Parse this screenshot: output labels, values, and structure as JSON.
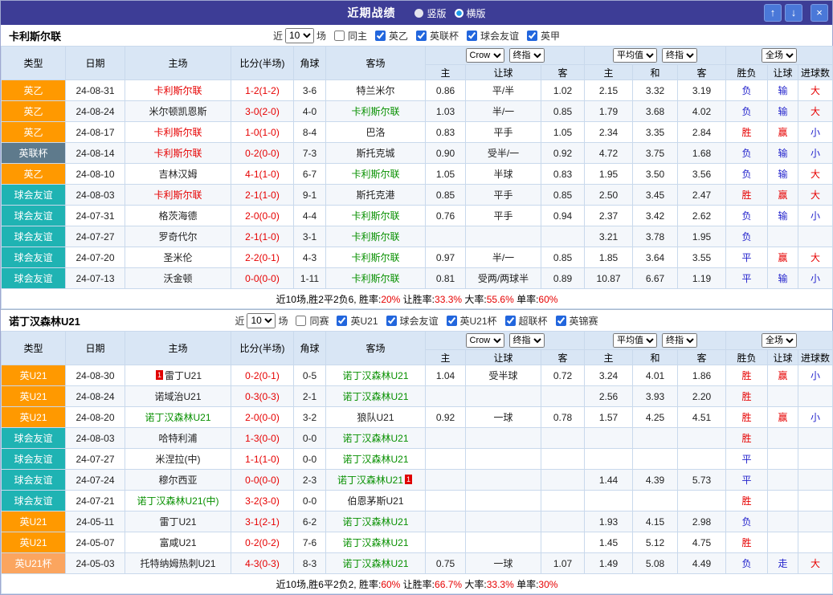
{
  "titlebar": {
    "title": "近期战绩",
    "radios": [
      {
        "label": "竖版",
        "selected": false
      },
      {
        "label": "横版",
        "selected": true
      }
    ],
    "buttons": [
      {
        "name": "up",
        "glyph": "↑"
      },
      {
        "name": "down",
        "glyph": "↓"
      },
      {
        "name": "close",
        "glyph": "×"
      }
    ]
  },
  "colors": {
    "topbar": "#3D3D96",
    "button_blue": "#4A78D8",
    "header_bg": "#D9E6F5",
    "grid_border": "#C9D9EC",
    "row_alt": "#F4F7FB",
    "red": "#E60000",
    "green": "#079000",
    "blue": "#2323CC",
    "badge_orange": "#FF9900",
    "badge_slate": "#5E7A8C",
    "badge_teal": "#1FB3B3",
    "badge_orangeLight": "#FBA55F"
  },
  "table_header": {
    "left_cols": [
      "类型",
      "日期",
      "主场",
      "比分(半场)",
      "角球",
      "客场"
    ],
    "group1": {
      "selects": [
        "Crow",
        "终指"
      ],
      "cols": [
        "主",
        "让球",
        "客"
      ]
    },
    "group2": {
      "selects": [
        "平均值",
        "终指"
      ],
      "cols": [
        "主",
        "和",
        "客"
      ]
    },
    "group3": {
      "selects": [
        "全场"
      ],
      "cols": [
        "胜负",
        "让球",
        "进球数"
      ]
    }
  },
  "sections": [
    {
      "team": "卡利斯尔联",
      "controls": {
        "near_label": "近",
        "count": "10",
        "matches_label": "场",
        "same_label": "同主",
        "same_checked": false,
        "leagues": [
          {
            "label": "英乙",
            "checked": true
          },
          {
            "label": "英联杯",
            "checked": true
          },
          {
            "label": "球会友谊",
            "checked": true
          },
          {
            "label": "英甲",
            "checked": true
          }
        ]
      },
      "rows": [
        {
          "type": "英乙",
          "tc": "orange",
          "date": "24-08-31",
          "home": "卡利斯尔联",
          "hc": "red",
          "score": "1-2(1-2)",
          "corner": "3-6",
          "away": "特兰米尔",
          "ac": "",
          "o1": "0.86",
          "o2": "平/半",
          "o3": "1.02",
          "a1": "2.15",
          "a2": "3.32",
          "a3": "3.19",
          "r1": "负",
          "r1c": "blue",
          "r2": "输",
          "r2c": "blue",
          "r3": "大",
          "r3c": "red"
        },
        {
          "type": "英乙",
          "tc": "orange",
          "date": "24-08-24",
          "home": "米尔顿凯恩斯",
          "hc": "",
          "score": "3-0(2-0)",
          "corner": "4-0",
          "away": "卡利斯尔联",
          "ac": "green",
          "o1": "1.03",
          "o2": "半/一",
          "o3": "0.85",
          "a1": "1.79",
          "a2": "3.68",
          "a3": "4.02",
          "r1": "负",
          "r1c": "blue",
          "r2": "输",
          "r2c": "blue",
          "r3": "大",
          "r3c": "red"
        },
        {
          "type": "英乙",
          "tc": "orange",
          "date": "24-08-17",
          "home": "卡利斯尔联",
          "hc": "red",
          "score": "1-0(1-0)",
          "corner": "8-4",
          "away": "巴洛",
          "ac": "",
          "o1": "0.83",
          "o2": "平手",
          "o3": "1.05",
          "a1": "2.34",
          "a2": "3.35",
          "a3": "2.84",
          "r1": "胜",
          "r1c": "red",
          "r2": "赢",
          "r2c": "red",
          "r3": "小",
          "r3c": "blue"
        },
        {
          "type": "英联杯",
          "tc": "slate",
          "date": "24-08-14",
          "home": "卡利斯尔联",
          "hc": "red",
          "score": "0-2(0-0)",
          "corner": "7-3",
          "away": "斯托克城",
          "ac": "",
          "o1": "0.90",
          "o2": "受半/一",
          "o3": "0.92",
          "a1": "4.72",
          "a2": "3.75",
          "a3": "1.68",
          "r1": "负",
          "r1c": "blue",
          "r2": "输",
          "r2c": "blue",
          "r3": "小",
          "r3c": "blue"
        },
        {
          "type": "英乙",
          "tc": "orange",
          "date": "24-08-10",
          "home": "吉林汉姆",
          "hc": "",
          "score": "4-1(1-0)",
          "corner": "6-7",
          "away": "卡利斯尔联",
          "ac": "green",
          "o1": "1.05",
          "o2": "半球",
          "o3": "0.83",
          "a1": "1.95",
          "a2": "3.50",
          "a3": "3.56",
          "r1": "负",
          "r1c": "blue",
          "r2": "输",
          "r2c": "blue",
          "r3": "大",
          "r3c": "red"
        },
        {
          "type": "球会友谊",
          "tc": "teal",
          "date": "24-08-03",
          "home": "卡利斯尔联",
          "hc": "red",
          "score": "2-1(1-0)",
          "corner": "9-1",
          "away": "斯托克港",
          "ac": "",
          "o1": "0.85",
          "o2": "平手",
          "o3": "0.85",
          "a1": "2.50",
          "a2": "3.45",
          "a3": "2.47",
          "r1": "胜",
          "r1c": "red",
          "r2": "赢",
          "r2c": "red",
          "r3": "大",
          "r3c": "red"
        },
        {
          "type": "球会友谊",
          "tc": "teal",
          "date": "24-07-31",
          "home": "格茨海德",
          "hc": "",
          "score": "2-0(0-0)",
          "corner": "4-4",
          "away": "卡利斯尔联",
          "ac": "green",
          "o1": "0.76",
          "o2": "平手",
          "o3": "0.94",
          "a1": "2.37",
          "a2": "3.42",
          "a3": "2.62",
          "r1": "负",
          "r1c": "blue",
          "r2": "输",
          "r2c": "blue",
          "r3": "小",
          "r3c": "blue"
        },
        {
          "type": "球会友谊",
          "tc": "teal",
          "date": "24-07-27",
          "home": "罗奇代尔",
          "hc": "",
          "score": "2-1(1-0)",
          "corner": "3-1",
          "away": "卡利斯尔联",
          "ac": "green",
          "a1": "3.21",
          "a2": "3.78",
          "a3": "1.95",
          "r1": "负",
          "r1c": "blue"
        },
        {
          "type": "球会友谊",
          "tc": "teal",
          "date": "24-07-20",
          "home": "圣米伦",
          "hc": "",
          "score": "2-2(0-1)",
          "corner": "4-3",
          "away": "卡利斯尔联",
          "ac": "green",
          "o1": "0.97",
          "o2": "半/一",
          "o3": "0.85",
          "a1": "1.85",
          "a2": "3.64",
          "a3": "3.55",
          "r1": "平",
          "r1c": "blue",
          "r2": "赢",
          "r2c": "red",
          "r3": "大",
          "r3c": "red"
        },
        {
          "type": "球会友谊",
          "tc": "teal",
          "date": "24-07-13",
          "home": "沃金顿",
          "hc": "",
          "score": "0-0(0-0)",
          "corner": "1-11",
          "away": "卡利斯尔联",
          "ac": "green",
          "o1": "0.81",
          "o2": "受两/两球半",
          "o3": "0.89",
          "a1": "10.87",
          "a2": "6.67",
          "a3": "1.19",
          "r1": "平",
          "r1c": "blue",
          "r2": "输",
          "r2c": "blue",
          "r3": "小",
          "r3c": "blue"
        }
      ],
      "summary": [
        {
          "t": "近10场,胜2平2负6, 胜率:",
          "red": false
        },
        {
          "t": "20%",
          "red": true
        },
        {
          "t": " 让胜率:",
          "red": false
        },
        {
          "t": "33.3%",
          "red": true
        },
        {
          "t": " 大率:",
          "red": false
        },
        {
          "t": "55.6%",
          "red": true
        },
        {
          "t": " 单率:",
          "red": false
        },
        {
          "t": "60%",
          "red": true
        }
      ]
    },
    {
      "team": "诺丁汉森林U21",
      "controls": {
        "near_label": "近",
        "count": "10",
        "matches_label": "场",
        "same_label": "同赛",
        "same_checked": false,
        "leagues": [
          {
            "label": "英U21",
            "checked": true
          },
          {
            "label": "球会友谊",
            "checked": true
          },
          {
            "label": "英U21杯",
            "checked": true
          },
          {
            "label": "超联杯",
            "checked": true
          },
          {
            "label": "英锦赛",
            "checked": true
          }
        ]
      },
      "rows": [
        {
          "type": "英U21",
          "tc": "orange",
          "date": "24-08-30",
          "home": "雷丁U21",
          "hc": "",
          "hcard": "1",
          "score": "0-2(0-1)",
          "corner": "0-5",
          "away": "诺丁汉森林U21",
          "ac": "green",
          "o1": "1.04",
          "o2": "受半球",
          "o3": "0.72",
          "a1": "3.24",
          "a2": "4.01",
          "a3": "1.86",
          "r1": "胜",
          "r1c": "red",
          "r2": "赢",
          "r2c": "red",
          "r3": "小",
          "r3c": "blue"
        },
        {
          "type": "英U21",
          "tc": "orange",
          "date": "24-08-24",
          "home": "诺域治U21",
          "hc": "",
          "score": "0-3(0-3)",
          "corner": "2-1",
          "away": "诺丁汉森林U21",
          "ac": "green",
          "a1": "2.56",
          "a2": "3.93",
          "a3": "2.20",
          "r1": "胜",
          "r1c": "red"
        },
        {
          "type": "英U21",
          "tc": "orange",
          "date": "24-08-20",
          "home": "诺丁汉森林U21",
          "hc": "green",
          "score": "2-0(0-0)",
          "corner": "3-2",
          "away": "狼队U21",
          "ac": "",
          "o1": "0.92",
          "o2": "一球",
          "o3": "0.78",
          "a1": "1.57",
          "a2": "4.25",
          "a3": "4.51",
          "r1": "胜",
          "r1c": "red",
          "r2": "赢",
          "r2c": "red",
          "r3": "小",
          "r3c": "blue"
        },
        {
          "type": "球会友谊",
          "tc": "teal",
          "date": "24-08-03",
          "home": "哈特利浦",
          "hc": "",
          "score": "1-3(0-0)",
          "corner": "0-0",
          "away": "诺丁汉森林U21",
          "ac": "green",
          "r1": "胜",
          "r1c": "red"
        },
        {
          "type": "球会友谊",
          "tc": "teal",
          "date": "24-07-27",
          "home": "米涅拉(中)",
          "hc": "",
          "score": "1-1(1-0)",
          "corner": "0-0",
          "away": "诺丁汉森林U21",
          "ac": "green",
          "r1": "平",
          "r1c": "blue"
        },
        {
          "type": "球会友谊",
          "tc": "teal",
          "date": "24-07-24",
          "home": "穆尔西亚",
          "hc": "",
          "score": "0-0(0-0)",
          "corner": "2-3",
          "away": "诺丁汉森林U21",
          "ac": "green",
          "acard": "1",
          "a1": "1.44",
          "a2": "4.39",
          "a3": "5.73",
          "r1": "平",
          "r1c": "blue"
        },
        {
          "type": "球会友谊",
          "tc": "teal",
          "date": "24-07-21",
          "home": "诺丁汉森林U21(中)",
          "hc": "green",
          "score": "3-2(3-0)",
          "corner": "0-0",
          "away": "伯恩茅斯U21",
          "ac": "",
          "r1": "胜",
          "r1c": "red"
        },
        {
          "type": "英U21",
          "tc": "orange",
          "date": "24-05-11",
          "home": "雷丁U21",
          "hc": "",
          "score": "3-1(2-1)",
          "corner": "6-2",
          "away": "诺丁汉森林U21",
          "ac": "green",
          "a1": "1.93",
          "a2": "4.15",
          "a3": "2.98",
          "r1": "负",
          "r1c": "blue"
        },
        {
          "type": "英U21",
          "tc": "orange",
          "date": "24-05-07",
          "home": "富咸U21",
          "hc": "",
          "score": "0-2(0-2)",
          "corner": "7-6",
          "away": "诺丁汉森林U21",
          "ac": "green",
          "a1": "1.45",
          "a2": "5.12",
          "a3": "4.75",
          "r1": "胜",
          "r1c": "red"
        },
        {
          "type": "英U21杯",
          "tc": "orangeLight",
          "date": "24-05-03",
          "home": "托特纳姆热刺U21",
          "hc": "",
          "score": "4-3(0-3)",
          "corner": "8-3",
          "away": "诺丁汉森林U21",
          "ac": "green",
          "o1": "0.75",
          "o2": "一球",
          "o3": "1.07",
          "a1": "1.49",
          "a2": "5.08",
          "a3": "4.49",
          "r1": "负",
          "r1c": "blue",
          "r2": "走",
          "r2c": "blue",
          "r3": "大",
          "r3c": "red"
        }
      ],
      "summary": [
        {
          "t": "近10场,胜6平2负2, 胜率:",
          "red": false
        },
        {
          "t": "60%",
          "red": true
        },
        {
          "t": " 让胜率:",
          "red": false
        },
        {
          "t": "66.7%",
          "red": true
        },
        {
          "t": " 大率:",
          "red": false
        },
        {
          "t": "33.3%",
          "red": true
        },
        {
          "t": " 单率:",
          "red": false
        },
        {
          "t": "30%",
          "red": true
        }
      ]
    }
  ]
}
